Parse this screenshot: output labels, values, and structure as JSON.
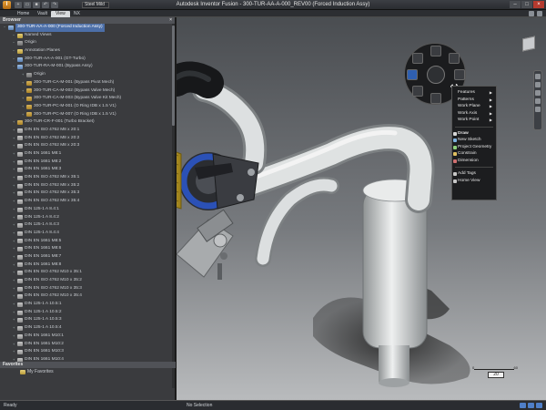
{
  "app": {
    "icon_letter": "I",
    "window_title": "Autodesk Inventor Fusion - 300-TUR-AA-A-000_REV00 (Forced Induction Assy)",
    "project_select": "Steel Mild"
  },
  "tabs": [
    {
      "label": "Home",
      "active": false
    },
    {
      "label": "Vault",
      "active": false
    },
    {
      "label": "View",
      "active": true
    },
    {
      "label": "NX",
      "active": false
    }
  ],
  "browser": {
    "header": "Browser",
    "close": "×",
    "rows": [
      {
        "label": "300-TUR-AA-A-000 (Forced Induction Assy)",
        "indent": 0,
        "icon": "asm",
        "selected": true
      },
      {
        "label": "Named Views",
        "indent": 1,
        "icon": "folder"
      },
      {
        "label": "Origin",
        "indent": 1,
        "icon": "origin"
      },
      {
        "label": "Annotation Planes",
        "indent": 1,
        "icon": "folder"
      },
      {
        "label": "300-TUR-AA-A-001 (GT-Turbo)",
        "indent": 1,
        "icon": "asm"
      },
      {
        "label": "300-TUR-RA-M-001 (Bypass Assy)",
        "indent": 1,
        "icon": "asm"
      },
      {
        "label": "Origin",
        "indent": 2,
        "icon": "origin"
      },
      {
        "label": "300-TUR-CA-M-001 (Bypass Pivot Mech)",
        "indent": 2,
        "icon": "part"
      },
      {
        "label": "300-TUR-CA-M-002 (Bypass Valve Mech)",
        "indent": 2,
        "icon": "part"
      },
      {
        "label": "300-TUR-CA-M-003 (Bypass Valve Kit Mech)",
        "indent": 2,
        "icon": "part"
      },
      {
        "label": "300-TUR-PC-M-001 (O Ring IDB x 1.5 V1)",
        "indent": 2,
        "icon": "part"
      },
      {
        "label": "300-TUR-PC-M-007 (O Ring IDB x 1.5 V1)",
        "indent": 2,
        "icon": "part"
      },
      {
        "label": "300-TUR-CR-F-001 (Turbo Bracket)",
        "indent": 1,
        "icon": "part"
      },
      {
        "label": "DIN EN ISO 4762 M8 x 20:1",
        "indent": 1,
        "icon": "fastener"
      },
      {
        "label": "DIN EN ISO 4762 M8 x 20:2",
        "indent": 1,
        "icon": "fastener"
      },
      {
        "label": "DIN EN ISO 4762 M8 x 20:3",
        "indent": 1,
        "icon": "fastener"
      },
      {
        "label": "DIN EN 1661 M8:1",
        "indent": 1,
        "icon": "fastener"
      },
      {
        "label": "DIN EN 1661 M8:2",
        "indent": 1,
        "icon": "fastener"
      },
      {
        "label": "DIN EN 1661 M8:3",
        "indent": 1,
        "icon": "fastener"
      },
      {
        "label": "DIN EN ISO 4762 M8 x 35:1",
        "indent": 1,
        "icon": "fastener"
      },
      {
        "label": "DIN EN ISO 4762 M8 x 35:2",
        "indent": 1,
        "icon": "fastener"
      },
      {
        "label": "DIN EN ISO 4762 M8 x 35:3",
        "indent": 1,
        "icon": "fastener"
      },
      {
        "label": "DIN EN ISO 4762 M8 x 35:4",
        "indent": 1,
        "icon": "fastener"
      },
      {
        "label": "DIN 125-1 A 8.4:1",
        "indent": 1,
        "icon": "fastener"
      },
      {
        "label": "DIN 125-1 A 8.4:2",
        "indent": 1,
        "icon": "fastener"
      },
      {
        "label": "DIN 125-1 A 8.4:3",
        "indent": 1,
        "icon": "fastener"
      },
      {
        "label": "DIN 125-1 A 8.4:4",
        "indent": 1,
        "icon": "fastener"
      },
      {
        "label": "DIN EN 1661 M8:5",
        "indent": 1,
        "icon": "fastener"
      },
      {
        "label": "DIN EN 1661 M8:6",
        "indent": 1,
        "icon": "fastener"
      },
      {
        "label": "DIN EN 1661 M8:7",
        "indent": 1,
        "icon": "fastener"
      },
      {
        "label": "DIN EN 1661 M8:8",
        "indent": 1,
        "icon": "fastener"
      },
      {
        "label": "DIN EN ISO 4762 M10 x 35:1",
        "indent": 1,
        "icon": "fastener"
      },
      {
        "label": "DIN EN ISO 4762 M10 x 35:2",
        "indent": 1,
        "icon": "fastener"
      },
      {
        "label": "DIN EN ISO 4762 M10 x 35:3",
        "indent": 1,
        "icon": "fastener"
      },
      {
        "label": "DIN EN ISO 4762 M10 x 35:4",
        "indent": 1,
        "icon": "fastener"
      },
      {
        "label": "DIN 125-1 A 10.5:1",
        "indent": 1,
        "icon": "fastener"
      },
      {
        "label": "DIN 125-1 A 10.5:2",
        "indent": 1,
        "icon": "fastener"
      },
      {
        "label": "DIN 125-1 A 10.5:3",
        "indent": 1,
        "icon": "fastener"
      },
      {
        "label": "DIN 125-1 A 10.5:4",
        "indent": 1,
        "icon": "fastener"
      },
      {
        "label": "DIN EN 1661 M10:1",
        "indent": 1,
        "icon": "fastener"
      },
      {
        "label": "DIN EN 1661 M10:2",
        "indent": 1,
        "icon": "fastener"
      },
      {
        "label": "DIN EN 1661 M10:3",
        "indent": 1,
        "icon": "fastener"
      },
      {
        "label": "DIN EN 1661 M10:4",
        "indent": 1,
        "icon": "fastener"
      }
    ]
  },
  "favorites": {
    "header": "Favorites",
    "item": "My Favorites"
  },
  "context_menu": {
    "items": [
      {
        "label": "Features",
        "submenu": true
      },
      {
        "label": "Patterns",
        "submenu": true
      },
      {
        "label": "Work Plane",
        "submenu": true
      },
      {
        "label": "Work Axis",
        "submenu": true
      },
      {
        "label": "Work Point",
        "submenu": true
      },
      {
        "sep": true
      },
      {
        "label": "Draw",
        "icon": "#d8d8d8",
        "bold": true
      },
      {
        "label": "New Sketch",
        "icon": "#7fb3e0"
      },
      {
        "label": "Project Geometry",
        "icon": "#8fcf7a"
      },
      {
        "label": "Constrain",
        "icon": "#e0c060"
      },
      {
        "label": "Dimension",
        "icon": "#d07070"
      },
      {
        "sep": true
      },
      {
        "label": "Add Tags",
        "icon": "#c8c8c8"
      },
      {
        "label": "Home View",
        "icon": "#c8c8c8"
      }
    ]
  },
  "scale": {
    "min": "0",
    "max": "60",
    "value": "20"
  },
  "status": {
    "left": "Ready",
    "center": "No Selection"
  },
  "colors": {
    "pipe": "#d5d8d8",
    "intercooler": "#d7d9d9",
    "turbo_blue": "#2b51b6",
    "filter_gold": "#d2b23a",
    "hose_black": "#202226",
    "selection": "#4c6fa8"
  }
}
